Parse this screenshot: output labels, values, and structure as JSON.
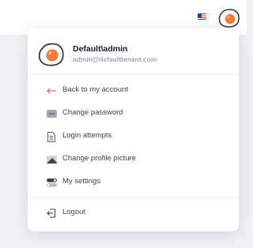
{
  "header": {
    "flag_icon": "us-flag-icon",
    "avatar_icon": "fried-egg-avatar-icon"
  },
  "user": {
    "name": "Default\\admin",
    "email": "admin@defaulttenant.com"
  },
  "menu": {
    "items": [
      {
        "label": "Back to my account",
        "icon": "arrow-left-icon"
      },
      {
        "label": "Change password",
        "icon": "password-icon"
      },
      {
        "label": "Login attempts",
        "icon": "document-list-icon"
      },
      {
        "label": "Change profile picture",
        "icon": "image-icon"
      },
      {
        "label": "My settings",
        "icon": "toggle-icon"
      }
    ],
    "logout": {
      "label": "Logout",
      "icon": "logout-icon"
    }
  },
  "colors": {
    "accent_red": "#e85a6b",
    "text_primary": "#181c32",
    "text_muted": "#a1a5b7",
    "avatar_orange": "#ee7d3f"
  }
}
